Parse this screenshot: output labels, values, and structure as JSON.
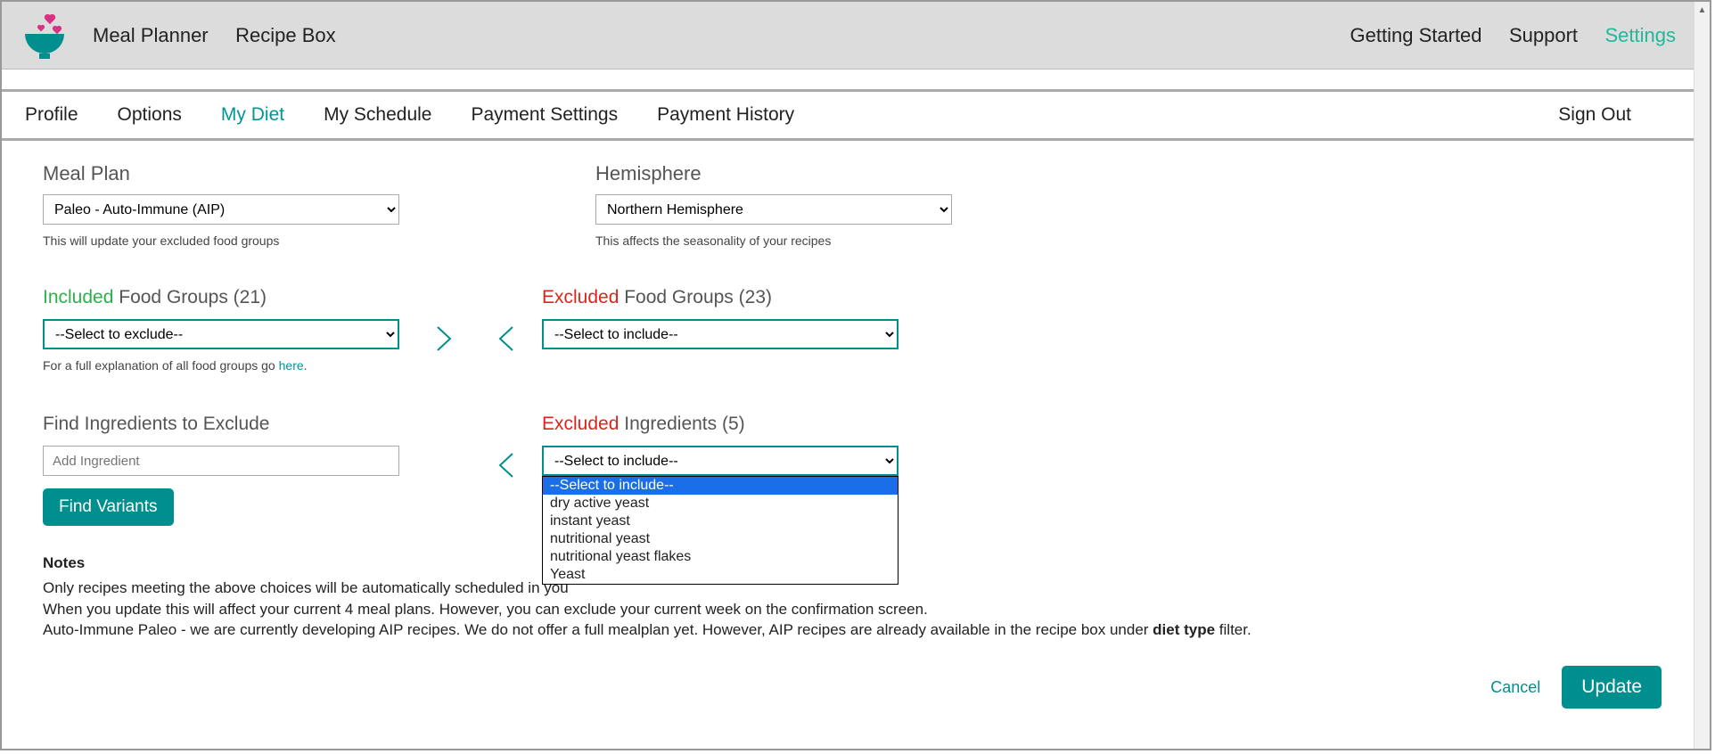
{
  "topnav": {
    "left": [
      "Meal Planner",
      "Recipe Box"
    ],
    "right": [
      "Getting Started",
      "Support",
      "Settings"
    ],
    "active_right_index": 2
  },
  "subnav": {
    "items": [
      "Profile",
      "Options",
      "My Diet",
      "My Schedule",
      "Payment Settings",
      "Payment History"
    ],
    "active_index": 2,
    "signout": "Sign Out"
  },
  "meal_plan": {
    "label": "Meal Plan",
    "value": "Paleo - Auto-Immune (AIP)",
    "helper": "This will update your excluded food groups"
  },
  "hemisphere": {
    "label": "Hemisphere",
    "value": "Northern Hemisphere",
    "helper": "This affects the seasonality of your recipes"
  },
  "included_groups": {
    "prefix": "Included",
    "label": "Food Groups",
    "count": "(21)",
    "placeholder": "--Select to exclude--",
    "helper_prefix": "For a full explanation of all food groups go ",
    "helper_link": "here"
  },
  "excluded_groups": {
    "prefix": "Excluded",
    "label": "Food Groups",
    "count": "(23)",
    "placeholder": "--Select to include--"
  },
  "find_ingredients": {
    "label": "Find Ingredients to Exclude",
    "placeholder": "Add Ingredient",
    "button": "Find Variants"
  },
  "excluded_ingredients": {
    "prefix": "Excluded",
    "label": "Ingredients",
    "count": "(5)",
    "placeholder": "--Select to include--",
    "options": [
      "--Select to include--",
      "dry active yeast",
      "instant yeast",
      "nutritional yeast",
      "nutritional yeast flakes",
      "Yeast"
    ]
  },
  "notes": {
    "title": "Notes",
    "line1": "Only recipes meeting the above choices will be automatically scheduled in you",
    "line2": "When you update this will affect your current 4 meal plans. However, you can exclude your current week on the confirmation screen.",
    "line3_a": "Auto-Immune Paleo - we are currently developing AIP recipes. We do not offer a full mealplan yet. However, AIP recipes are already available in the recipe box under ",
    "line3_bold": "diet type",
    "line3_b": " filter."
  },
  "footer": {
    "cancel": "Cancel",
    "update": "Update"
  }
}
